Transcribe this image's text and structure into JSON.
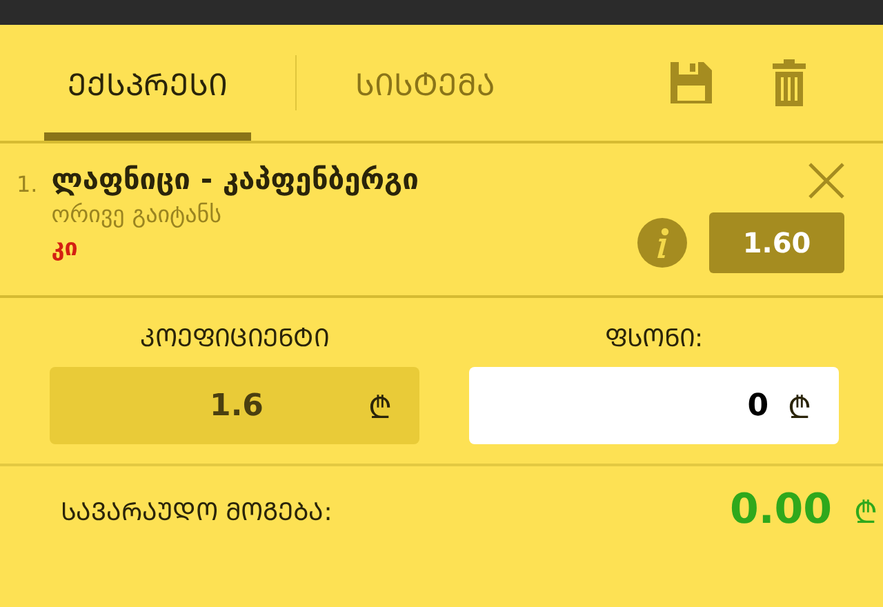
{
  "tabs": [
    {
      "label": "ᲔᲥᲡᲞᲠᲔᲡᲘ",
      "selected": true
    },
    {
      "label": "ᲡᲘᲡᲢᲔᲛᲐ",
      "selected": false
    }
  ],
  "bets": [
    {
      "number": "1.",
      "match": "ლაფნიცი - კაპფენბერგი",
      "market": "ორივე გაიტანს",
      "pick": "კი",
      "odds": "1.60"
    }
  ],
  "coefficient": {
    "label": "ᲙᲝᲔᲤᲘᲪᲘᲔᲜᲢᲘ",
    "value": "1.6",
    "currency": "₾"
  },
  "stake": {
    "label": "ᲤᲡᲝᲜᲘ:",
    "value": "0",
    "currency": "₾"
  },
  "winnings": {
    "label": "ᲡᲐᲕᲐᲠᲐᲣᲓᲝ ᲛᲝᲒᲔᲑᲐ:",
    "value": "0.00",
    "currency": "₾"
  }
}
